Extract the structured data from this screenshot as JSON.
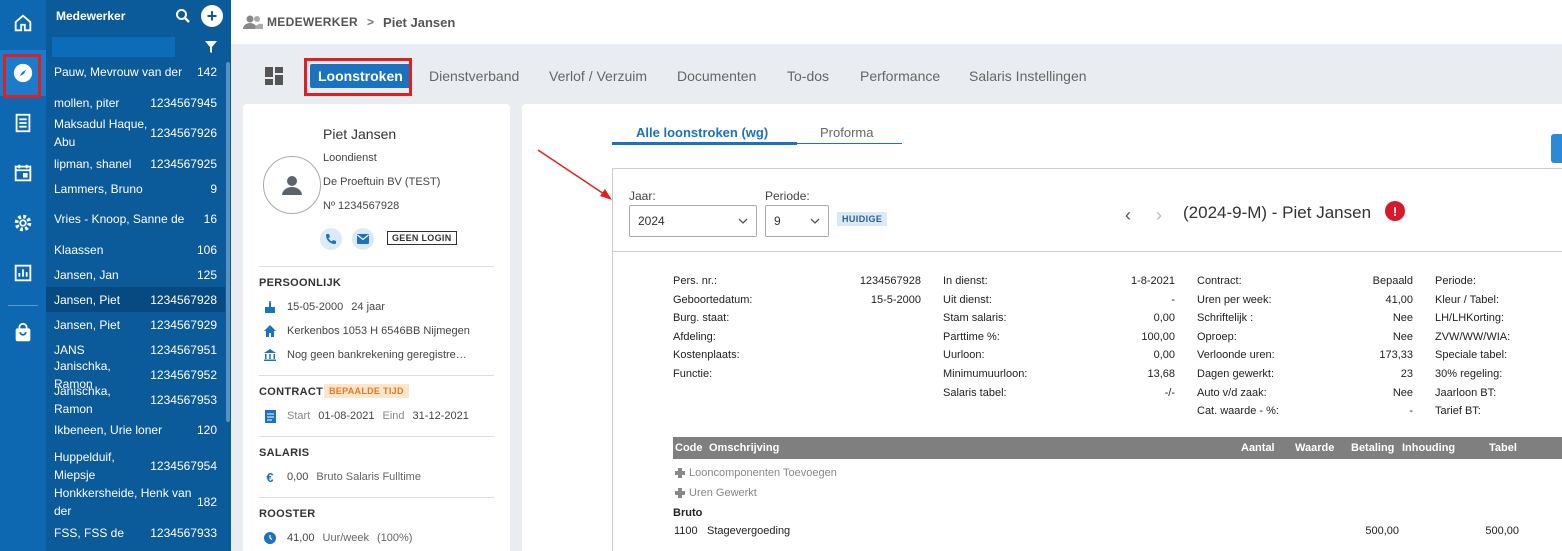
{
  "sidebar": {
    "icons": [
      "home-icon",
      "compass-icon",
      "document-list-icon",
      "calendar-icon",
      "gear-icon",
      "report-chart-icon",
      "shopping-bag-icon"
    ]
  },
  "employee_list": {
    "title": "Medewerker",
    "filter_placeholder": "",
    "items": [
      {
        "name": "Pauw, Mevrouw van der",
        "number": "142"
      },
      {
        "name": "mollen, piter",
        "number": "1234567945"
      },
      {
        "name": "Maksadul Haque, Abu",
        "number": "1234567926"
      },
      {
        "name": "lipman, shanel",
        "number": "1234567925"
      },
      {
        "name": "Lammers, Bruno",
        "number": "9"
      },
      {
        "name": "Vries - Knoop, Sanne de",
        "number": "16"
      },
      {
        "name": "Klaassen",
        "number": "106"
      },
      {
        "name": "Jansen, Jan",
        "number": "125"
      },
      {
        "name": "Jansen, Piet",
        "number": "1234567928"
      },
      {
        "name": "Jansen, Piet",
        "number": "1234567929"
      },
      {
        "name": "JANS",
        "number": "1234567951"
      },
      {
        "name": "Janischka, Ramon",
        "number": "1234567952"
      },
      {
        "name": "Janischka, Ramon",
        "number": "1234567953"
      },
      {
        "name": "Ikbeneen, Urie loner",
        "number": "120"
      },
      {
        "name": "Huppelduif, Miepsje",
        "number": "1234567954"
      },
      {
        "name": "Honkkersheide, Henk van der",
        "number": "182"
      },
      {
        "name": "FSS, FSS de",
        "number": "1234567933"
      }
    ]
  },
  "breadcrumb": {
    "root": "MEDEWERKER",
    "separator": ">",
    "current": "Piet Jansen"
  },
  "tabs": [
    {
      "label": "Loonstroken",
      "active": true
    },
    {
      "label": "Dienstverband"
    },
    {
      "label": "Verlof / Verzuim"
    },
    {
      "label": "Documenten"
    },
    {
      "label": "To-dos"
    },
    {
      "label": "Performance"
    },
    {
      "label": "Salaris Instellingen"
    }
  ],
  "profile": {
    "name": "Piet Jansen",
    "type": "Loondienst",
    "company": "De Proeftuin BV (TEST)",
    "number": "Nº 1234567928",
    "login_badge": "GEEN LOGIN",
    "personal": {
      "title": "PERSOONLIJK",
      "birthdate": "15-05-2000",
      "age": "24 jaar",
      "address": "Kerkenbos 1053 H 6546BB Nijmegen",
      "bank": "Nog geen bankrekening geregistre…"
    },
    "contract": {
      "title": "CONTRACT",
      "badge": "BEPAALDE TIJD",
      "start_label": "Start",
      "start": "01-08-2021",
      "end_label": "Eind",
      "end": "31-12-2021"
    },
    "salary": {
      "title": "SALARIS",
      "amount": "0,00",
      "description": "Bruto Salaris Fulltime"
    },
    "schedule": {
      "title": "ROOSTER",
      "hours": "41,00",
      "unit": "Uur/week",
      "percent": "(100%)"
    }
  },
  "payslip": {
    "subtabs": [
      {
        "label": "Alle loonstroken (wg)",
        "active": true
      },
      {
        "label": "Proforma"
      }
    ],
    "year_label": "Jaar:",
    "year": "2024",
    "period_label": "Periode:",
    "period": "9",
    "current_badge": "HUIDIGE",
    "prev_arrow": "‹",
    "next_arrow": "›",
    "title": "(2024-9-M) - Piet Jansen",
    "alert": "!",
    "col1": [
      {
        "label": "Pers. nr.:",
        "value": "1234567928"
      },
      {
        "label": "Geboortedatum:",
        "value": "15-5-2000"
      },
      {
        "label": "Burg. staat:",
        "value": ""
      },
      {
        "label": "Afdeling:",
        "value": ""
      },
      {
        "label": "Kostenplaats:",
        "value": ""
      },
      {
        "label": "Functie:",
        "value": ""
      }
    ],
    "col2": [
      {
        "label": "In dienst:",
        "value": "1-8-2021"
      },
      {
        "label": "Uit dienst:",
        "value": "-"
      },
      {
        "label": "Stam salaris:",
        "value": "0,00"
      },
      {
        "label": "Parttime %:",
        "value": "100,00"
      },
      {
        "label": "Uurloon:",
        "value": "0,00"
      },
      {
        "label": "Minimumuurloon:",
        "value": "13,68"
      },
      {
        "label": "Salaris tabel:",
        "value": "-/-"
      }
    ],
    "col3": [
      {
        "label": "Contract:",
        "value": "Bepaald"
      },
      {
        "label": "Uren per week:",
        "value": "41,00"
      },
      {
        "label": "Schriftelijk :",
        "value": "Nee"
      },
      {
        "label": "Oproep:",
        "value": "Nee"
      },
      {
        "label": "Verloonde uren:",
        "value": "173,33"
      },
      {
        "label": "Dagen gewerkt:",
        "value": "23"
      },
      {
        "label": "Auto v/d zaak:",
        "value": "Nee"
      },
      {
        "label": "Cat. waarde - %:",
        "value": "-"
      }
    ],
    "col4": [
      "Periode:",
      "Kleur / Tabel:",
      "LH/LHKorting:",
      "ZVW/WW/WIA:",
      "Speciale tabel:",
      "30% regeling:",
      "Jaarloon BT:",
      "Tarief BT:"
    ],
    "table_headers": [
      "Code",
      "Omschrijving",
      "Aantal",
      "Waarde",
      "Betaling",
      "Inhouding",
      "Tabel"
    ],
    "add_component": "Looncomponenten Toevoegen",
    "add_hours": "Uren Gewerkt",
    "section_bruto": "Bruto",
    "rows": [
      {
        "code": "1100",
        "description": "Stagevergoeding",
        "betaling": "500,00",
        "tabel": "500,00"
      }
    ]
  },
  "colors": {
    "primary": "#1a72c0",
    "rail": "#0e68b1",
    "list_bg": "#0b5a9a",
    "alert": "#d41a2b",
    "highlight_box": "#e02020"
  }
}
